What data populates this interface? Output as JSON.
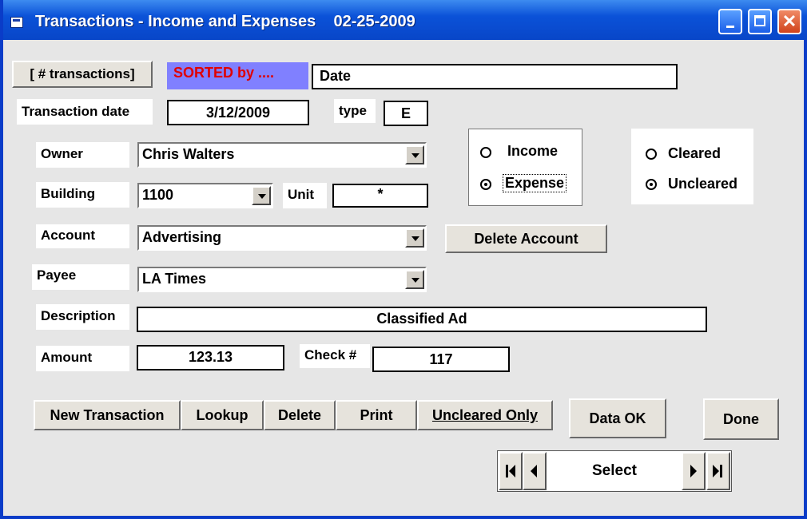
{
  "window": {
    "title": "Transactions - Income and Expenses    02-25-2009"
  },
  "header": {
    "count_button": "[ # transactions]",
    "sorted_label": "SORTED by ....",
    "sorted_value": "Date"
  },
  "form": {
    "transaction_date_label": "Transaction date",
    "transaction_date": "3/12/2009",
    "type_label": "type",
    "type_value": "E",
    "owner_label": "Owner",
    "owner_value": "Chris Walters",
    "building_label": "Building",
    "building_value": "1100",
    "unit_label": "Unit",
    "unit_value": "*",
    "account_label": "Account",
    "account_value": "Advertising",
    "payee_label": "Payee",
    "payee_value": "LA Times",
    "description_label": "Description",
    "description_value": "Classified Ad",
    "amount_label": "Amount",
    "amount_value": "123.13",
    "check_label": "Check #",
    "check_value": "117"
  },
  "income_expense": {
    "options": [
      "Income",
      "Expense"
    ],
    "selected": "Expense"
  },
  "cleared_status": {
    "options": [
      "Cleared",
      "Uncleared"
    ],
    "selected": "Uncleared"
  },
  "buttons": {
    "delete_account": "Delete Account",
    "new_transaction": "New Transaction",
    "lookup": "Lookup",
    "delete": "Delete",
    "print": "Print",
    "uncleared_only": "Uncleared Only",
    "data_ok": "Data OK",
    "done": "Done"
  },
  "navigator": {
    "caption": "Select",
    "first_icon": "first-record-icon",
    "prev_icon": "previous-record-icon",
    "next_icon": "next-record-icon",
    "last_icon": "last-record-icon"
  },
  "colors": {
    "titlebar": "#0b52d8",
    "sorted_bg": "#8080ff",
    "sorted_text": "#e00000"
  }
}
